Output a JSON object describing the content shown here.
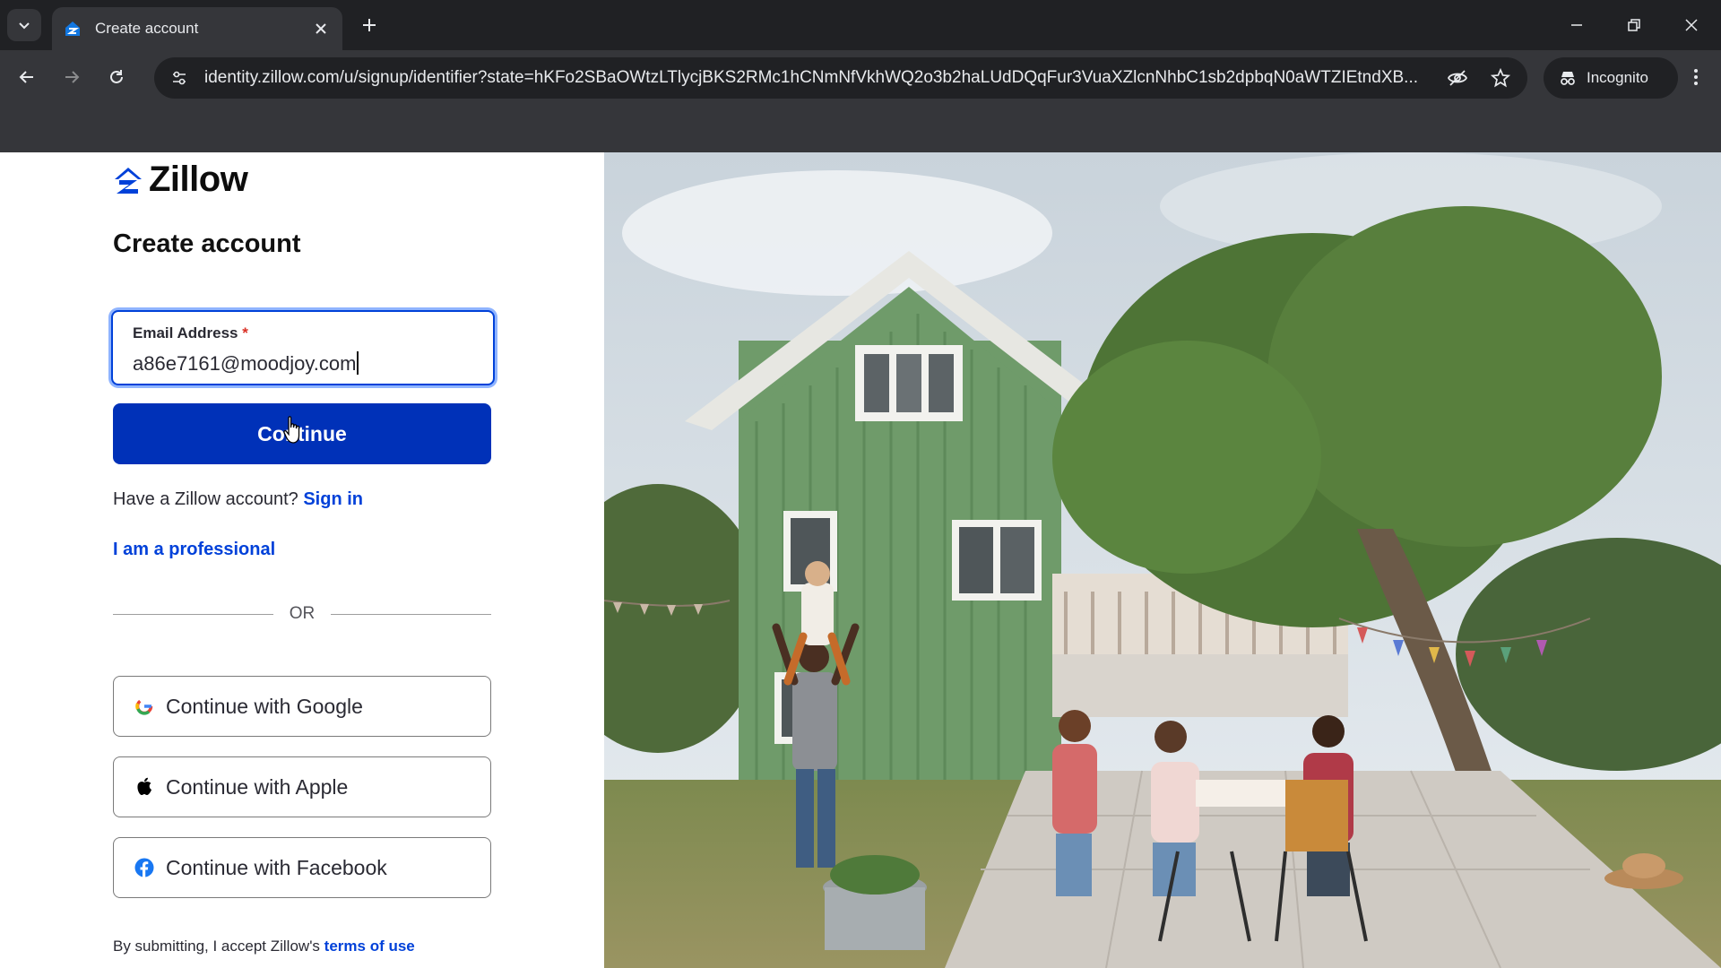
{
  "browser": {
    "tab_title": "Create account",
    "url": "identity.zillow.com/u/signup/identifier?state=hKFo2SBaOWtzLTlycjBKS2RMc1hCNmNfVkhWQ2o3b2haLUdDQqFur3VuaXZlcnNhbC1sb2dpbqN0aWTZIEtndXB...",
    "incognito_label": "Incognito"
  },
  "page": {
    "brand": "Zillow",
    "heading": "Create account",
    "email": {
      "label": "Email Address",
      "required_mark": "*",
      "value": "a86e7161@moodjoy.com"
    },
    "continue_label": "Continue",
    "have_account_text": "Have a Zillow account?",
    "sign_in_label": "Sign in",
    "professional_label": "I am a professional",
    "or_text": "OR",
    "social": {
      "google": "Continue with Google",
      "apple": "Continue with Apple",
      "facebook": "Continue with Facebook"
    },
    "terms_prefix": "By submitting, I accept Zillow's",
    "terms_link": "terms of use"
  },
  "colors": {
    "brand_blue": "#0041d9",
    "button_blue": "#0031b8",
    "chrome_dark": "#202124",
    "chrome_mid": "#35363a"
  },
  "hero_image": "family gathering in the backyard of a green house"
}
